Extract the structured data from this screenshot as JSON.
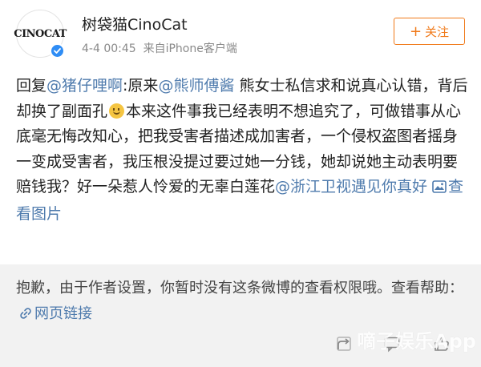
{
  "post": {
    "username": "树袋猫CinoCat",
    "timestamp": "4-4 00:45",
    "source_prefix": "来自",
    "source_device": "iPhone客户端",
    "follow_label": "关注",
    "follow_symbol": "+",
    "avatar_text": "CINOCAT",
    "content": {
      "reply_prefix": "回复",
      "mention1": "@猪仔哩啊",
      "seg1": ":原来",
      "mention2": "@熊师傅酱",
      "seg2": " 熊女士私信求和说真心认错，背后却换了副面孔",
      "seg3": "本来这件事我已经表明不想追究了，可做错事从心底毫无悔改知心，把我受害者描述成加害者，一个侵权盗图者摇身一变成受害者，我压根没提过要过她一分钱，她却说她主动表明要赔钱我？好一朵惹人怜爱的无辜白莲花",
      "mention3": "@浙江卫视遇见你真好",
      "view_images": "查看图片"
    }
  },
  "notice": {
    "text": "抱歉，由于作者设置，你暂时没有这条微博的查看权限哦。查看帮助：",
    "link_label": "网页链接"
  },
  "watermark": "嘀子娱乐App",
  "colors": {
    "accent_orange": "#f07a1a",
    "link_blue": "#4f7bad",
    "verified_blue": "#2f8df5",
    "notice_bg": "#f2f2f2"
  },
  "icons": [
    "verified-badge-icon",
    "smiley-emoji-icon",
    "image-icon",
    "link-icon",
    "repost-icon",
    "comment-icon",
    "like-icon"
  ]
}
